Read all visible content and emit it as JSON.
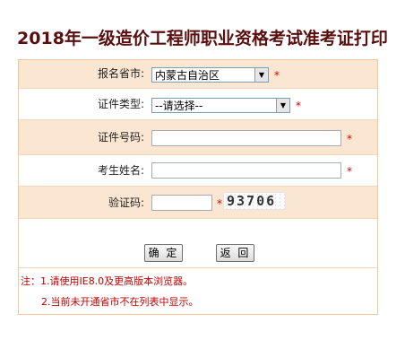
{
  "page": {
    "title": "2018年一级造价工程师职业资格考试准考证打印"
  },
  "form": {
    "province": {
      "label": "报名省市:",
      "value": "内蒙古自治区"
    },
    "id_type": {
      "label": "证件类型:",
      "value": "--请选择--"
    },
    "id_number": {
      "label": "证件号码:",
      "value": "",
      "placeholder": ""
    },
    "name": {
      "label": "考生姓名:",
      "value": "",
      "placeholder": ""
    },
    "captcha": {
      "label": "验证码:",
      "value": "",
      "image_text": "93706"
    },
    "required_mark": "*"
  },
  "buttons": {
    "confirm": "确 定",
    "back": "返 回"
  },
  "notes": {
    "line1": "注：1.请使用IE8.0及更高版本浏览器。",
    "line2": "2.当前未开通省市不在列表中显示。"
  },
  "colors": {
    "title": "#5a0f0f",
    "row_shade": "#fbe6d2",
    "border": "#f0c79e",
    "required": "#d40000"
  }
}
